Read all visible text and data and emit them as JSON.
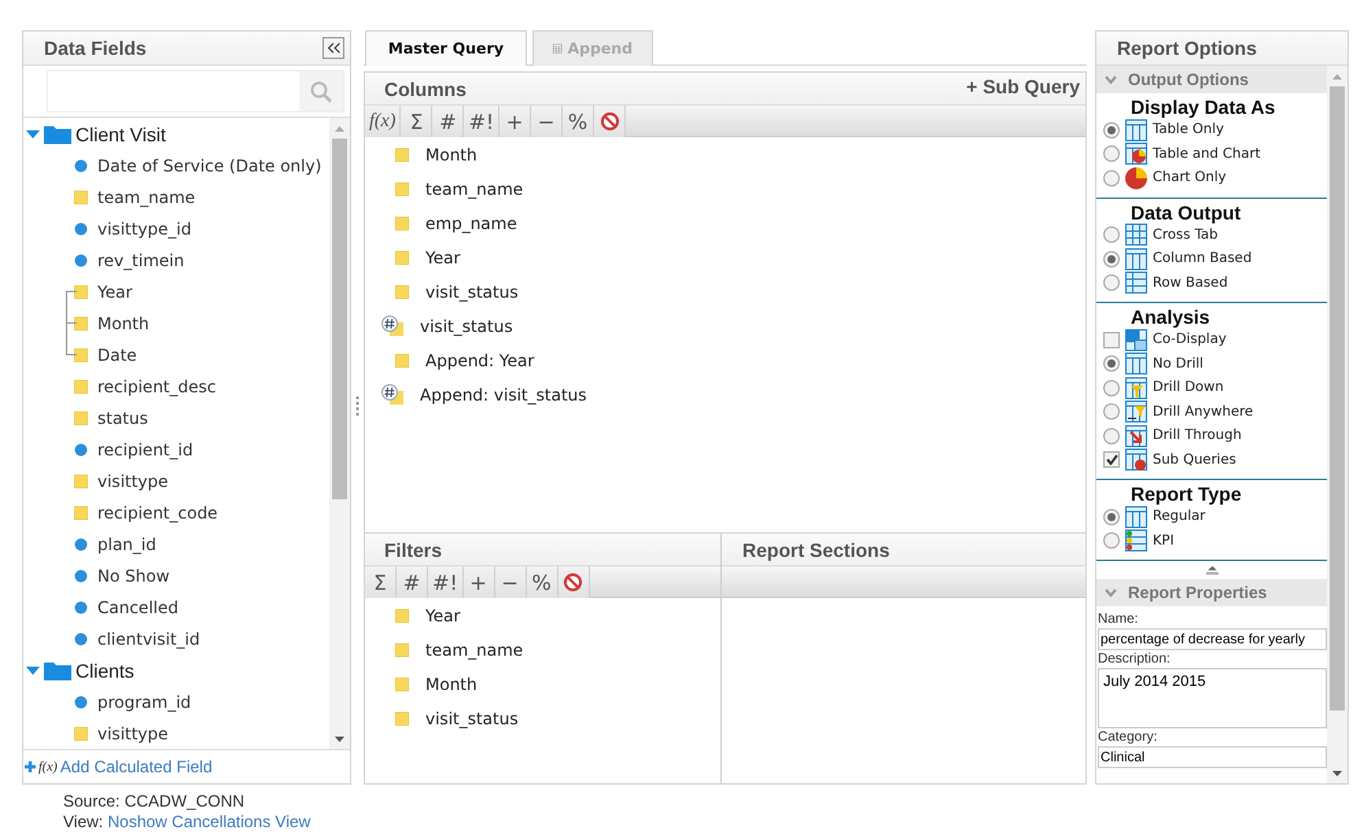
{
  "data_fields": {
    "title": "Data Fields",
    "tree": [
      {
        "label": "Client Visit",
        "kind": "folder",
        "expanded": true,
        "children": [
          {
            "label": "Date of Service (Date only)",
            "kind": "measure"
          },
          {
            "label": "team_name",
            "kind": "dimension"
          },
          {
            "label": "visittype_id",
            "kind": "measure"
          },
          {
            "label": "rev_timein",
            "kind": "measure"
          },
          {
            "label": "Year",
            "kind": "hierarchy"
          },
          {
            "label": "Month",
            "kind": "hierarchy"
          },
          {
            "label": "Date",
            "kind": "hierarchy"
          },
          {
            "label": "recipient_desc",
            "kind": "dimension"
          },
          {
            "label": "status",
            "kind": "dimension"
          },
          {
            "label": "recipient_id",
            "kind": "measure"
          },
          {
            "label": "visittype",
            "kind": "dimension"
          },
          {
            "label": "recipient_code",
            "kind": "dimension"
          },
          {
            "label": "plan_id",
            "kind": "measure"
          },
          {
            "label": "No Show",
            "kind": "measure"
          },
          {
            "label": "Cancelled",
            "kind": "measure"
          },
          {
            "label": "clientvisit_id",
            "kind": "measure"
          }
        ]
      },
      {
        "label": "Clients",
        "kind": "folder",
        "expanded": true,
        "children": [
          {
            "label": "program_id",
            "kind": "measure"
          },
          {
            "label": "visittype",
            "kind": "dimension"
          }
        ]
      }
    ],
    "add_field": {
      "fx": "f(x)",
      "label": "Add Calculated Field"
    }
  },
  "source": {
    "text": "Source: CCADW_CONN",
    "view_label": "View:",
    "view_link": "Noshow Cancellations View"
  },
  "tabs": [
    {
      "label": "Master Query",
      "selected": true
    },
    {
      "label": "Append",
      "selected": false
    }
  ],
  "columns_panel": {
    "title": "Columns",
    "sub_query": "+ Sub Query",
    "tools": [
      "f(x)",
      "Σ",
      "#",
      "#!",
      "+",
      "−",
      "%"
    ],
    "items": [
      {
        "label": "Month",
        "kind": "dimension"
      },
      {
        "label": "team_name",
        "kind": "dimension"
      },
      {
        "label": "emp_name",
        "kind": "dimension"
      },
      {
        "label": "Year",
        "kind": "dimension"
      },
      {
        "label": "visit_status",
        "kind": "dimension"
      },
      {
        "label": "visit_status",
        "kind": "count"
      },
      {
        "label": "Append: Year",
        "kind": "dimension"
      },
      {
        "label": "Append: visit_status",
        "kind": "count"
      }
    ]
  },
  "filters_panel": {
    "title": "Filters",
    "tools": [
      "Σ",
      "#",
      "#!",
      "+",
      "−",
      "%"
    ],
    "items": [
      {
        "label": "Year",
        "kind": "dimension"
      },
      {
        "label": "team_name",
        "kind": "dimension"
      },
      {
        "label": "Month",
        "kind": "dimension"
      },
      {
        "label": "visit_status",
        "kind": "dimension"
      }
    ]
  },
  "report_sections": {
    "title": "Report Sections"
  },
  "report_options": {
    "title": "Report Options",
    "output_options": {
      "title": "Output Options",
      "expanded": true,
      "groups": [
        {
          "title": "Display Data As",
          "options": [
            {
              "label": "Table Only",
              "kind": "radio",
              "selected": true
            },
            {
              "label": "Table and Chart",
              "kind": "radio",
              "selected": false
            },
            {
              "label": "Chart Only",
              "kind": "radio",
              "selected": false
            }
          ]
        },
        {
          "title": "Data Output",
          "options": [
            {
              "label": "Cross Tab",
              "kind": "radio",
              "selected": false
            },
            {
              "label": "Column Based",
              "kind": "radio",
              "selected": true
            },
            {
              "label": "Row Based",
              "kind": "radio",
              "selected": false
            }
          ]
        },
        {
          "title": "Analysis",
          "options": [
            {
              "label": "Co-Display",
              "kind": "checkbox",
              "checked": false
            },
            {
              "label": "No Drill",
              "kind": "radio",
              "selected": true
            },
            {
              "label": "Drill Down",
              "kind": "radio",
              "selected": false
            },
            {
              "label": "Drill Anywhere",
              "kind": "radio",
              "selected": false
            },
            {
              "label": "Drill Through",
              "kind": "radio",
              "selected": false
            },
            {
              "label": "Sub Queries",
              "kind": "checkbox",
              "checked": true
            }
          ]
        },
        {
          "title": "Report Type",
          "options": [
            {
              "label": "Regular",
              "kind": "radio",
              "selected": true
            },
            {
              "label": "KPI",
              "kind": "radio",
              "selected": false
            }
          ]
        }
      ]
    },
    "report_properties": {
      "title": "Report Properties",
      "expanded": true,
      "name_label": "Name:",
      "name_value": "percentage of decrease for yearly",
      "description_label": "Description:",
      "description_value": "July 2014 2015",
      "category_label": "Category:",
      "category_value": "Clinical"
    }
  }
}
